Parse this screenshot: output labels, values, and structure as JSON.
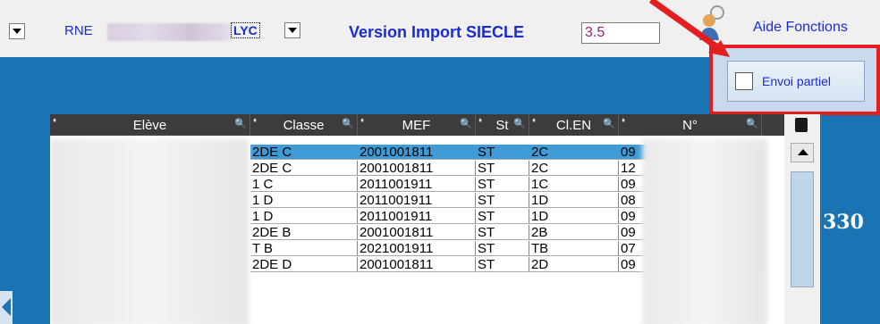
{
  "toolbar": {
    "rne_label": "RNE",
    "lyc_label": "LYC",
    "version_label": "Version Import SIECLE",
    "version_value": "3.5",
    "aide_label": "Aide Fonctions"
  },
  "envoi": {
    "label": "Envoi partiel",
    "checked": false
  },
  "grid": {
    "columns": [
      "Elève",
      "Classe",
      "MEF",
      "St",
      "Cl.EN",
      "N°"
    ],
    "rows": [
      {
        "classe": "2DE C",
        "mef": "2001001811",
        "st": "ST",
        "clen": "2C",
        "num": "09",
        "selected": true
      },
      {
        "classe": "2DE C",
        "mef": "2001001811",
        "st": "ST",
        "clen": "2C",
        "num": "12",
        "selected": false
      },
      {
        "classe": "1 C",
        "mef": "2011001911",
        "st": "ST",
        "clen": "1C",
        "num": "09",
        "selected": false
      },
      {
        "classe": "1 D",
        "mef": "2011001911",
        "st": "ST",
        "clen": "1D",
        "num": "08",
        "selected": false
      },
      {
        "classe": "1 D",
        "mef": "2011001911",
        "st": "ST",
        "clen": "1D",
        "num": "09",
        "selected": false
      },
      {
        "classe": "2DE B",
        "mef": "2001001811",
        "st": "ST",
        "clen": "2B",
        "num": "09",
        "selected": false
      },
      {
        "classe": "T B",
        "mef": "2021001911",
        "st": "ST",
        "clen": "TB",
        "num": "07",
        "selected": false
      },
      {
        "classe": "2DE D",
        "mef": "2001001811",
        "st": "ST",
        "clen": "2D",
        "num": "09",
        "selected": false
      }
    ]
  },
  "summary": {
    "count": "330"
  },
  "colors": {
    "background": "#1a73b3",
    "label_blue": "#1b2bd1",
    "selection": "#3f9bd6",
    "annotation_red": "#e41e1e"
  }
}
